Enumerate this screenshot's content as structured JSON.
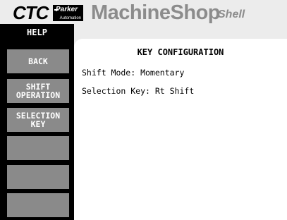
{
  "header": {
    "logo_ctc": "CTC",
    "logo_parker": "Parker",
    "logo_parker_sub": "Automation",
    "title": "MachineShop",
    "subtitle": "Shell"
  },
  "sidebar": {
    "title": "HELP",
    "buttons": [
      {
        "line1": "BACK",
        "line2": ""
      },
      {
        "line1": "SHIFT",
        "line2": "OPERATION"
      },
      {
        "line1": "SELECTION",
        "line2": "KEY"
      },
      {
        "line1": "",
        "line2": ""
      },
      {
        "line1": "",
        "line2": ""
      },
      {
        "line1": "",
        "line2": ""
      }
    ]
  },
  "panel": {
    "title": "KEY CONFIGURATION",
    "shift_mode": "Shift Mode: Momentary",
    "selection_key": "Selection Key: Rt Shift"
  },
  "colors": {
    "background": "#ececec",
    "sidebar": "#000000",
    "button": "#8a8a8a",
    "title_gray": "#8c8c8c"
  }
}
